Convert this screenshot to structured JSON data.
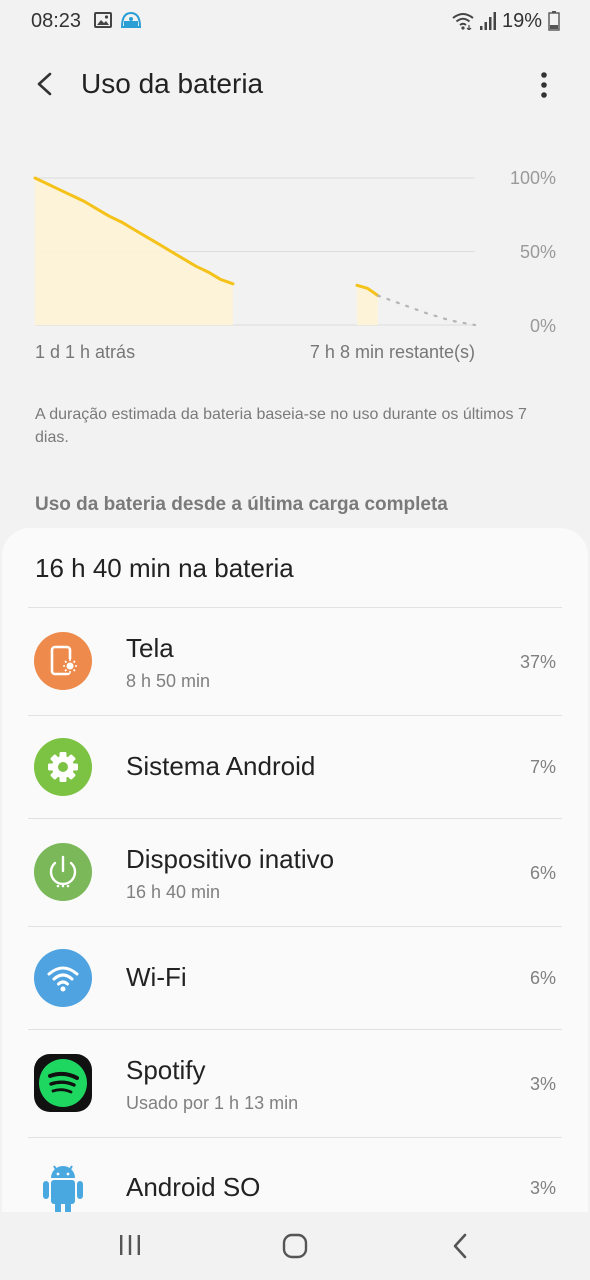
{
  "status_bar": {
    "time": "08:23",
    "battery_text": "19%",
    "icons": [
      "image-icon",
      "app-notification-icon",
      "wifi-icon",
      "signal-icon",
      "battery-icon"
    ]
  },
  "header": {
    "title": "Uso da bateria",
    "back_icon": "back-arrow-icon",
    "more_icon": "more-options-icon"
  },
  "chart_data": {
    "type": "area",
    "y_tick_labels": [
      "100%",
      "50%",
      "0%"
    ],
    "ylim": [
      0,
      100
    ],
    "x_start_label": "1 d 1 h atrás",
    "x_end_label": "7 h 8 min restante(s)",
    "grid": true,
    "colors": {
      "line": "#f5c21a",
      "fill": "#fdf3d6",
      "projection": "#b5b5b5"
    },
    "series": [
      {
        "values": [
          100,
          96,
          92,
          88,
          84,
          79,
          74,
          70,
          65,
          60,
          55,
          50,
          45,
          40,
          36,
          31,
          28
        ],
        "kind": "history-segment-1"
      },
      {
        "values": [
          27,
          25,
          20
        ],
        "kind": "history-segment-2"
      },
      {
        "values": [
          20,
          14,
          8,
          3,
          0
        ],
        "kind": "projection"
      }
    ]
  },
  "note": "A duração estimada da bateria baseia-se no uso durante os últimos 7 dias.",
  "section_title": "Uso da bateria desde a última carga completa",
  "usage": {
    "total": "16 h 40 min na bateria",
    "items": [
      {
        "name": "Tela",
        "sub": "8 h 50 min",
        "percent": "37%",
        "icon": "screen-brightness-icon",
        "color": "#ee8a4c"
      },
      {
        "name": "Sistema Android",
        "sub": "",
        "percent": "7%",
        "icon": "gear-icon",
        "color": "#7cc243"
      },
      {
        "name": "Dispositivo inativo",
        "sub": "16 h 40 min",
        "percent": "6%",
        "icon": "power-icon",
        "color": "#7ab85a"
      },
      {
        "name": "Wi-Fi",
        "sub": "",
        "percent": "6%",
        "icon": "wifi-icon",
        "color": "#4fa3e0"
      },
      {
        "name": "Spotify",
        "sub": "Usado por 1 h 13 min",
        "percent": "3%",
        "icon": "spotify-icon",
        "color": "#1ed760"
      },
      {
        "name": "Android SO",
        "sub": "",
        "percent": "3%",
        "icon": "android-icon",
        "color": "#4aa8e0"
      }
    ]
  },
  "nav_bar": {
    "recents_icon": "recents-icon",
    "home_icon": "home-icon",
    "back_icon": "back-icon"
  }
}
